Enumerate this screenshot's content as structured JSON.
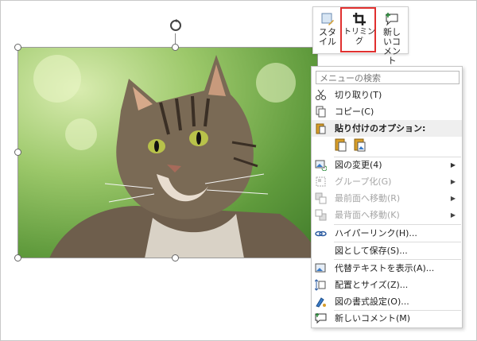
{
  "mini_toolbar": {
    "style_label": "スタイル",
    "trim_label": "トリミング",
    "comment_label": "新しいコメント"
  },
  "menu": {
    "search_placeholder": "メニューの検索",
    "items": [
      {
        "label": "切り取り(T)",
        "icon": "scissors-icon",
        "enabled": true
      },
      {
        "label": "コピー(C)",
        "icon": "copy-icon",
        "enabled": true
      },
      {
        "label": "貼り付けのオプション:",
        "icon": "paste-icon",
        "enabled": true,
        "header": true
      },
      {
        "label": "図の変更(4)",
        "icon": "change-picture-icon",
        "enabled": true,
        "submenu": true
      },
      {
        "label": "グループ化(G)",
        "icon": "group-icon",
        "enabled": false,
        "submenu": true
      },
      {
        "label": "最前面へ移動(R)",
        "icon": "bring-front-icon",
        "enabled": false,
        "submenu": true
      },
      {
        "label": "最背面へ移動(K)",
        "icon": "send-back-icon",
        "enabled": false,
        "submenu": true
      },
      {
        "label": "ハイパーリンク(H)...",
        "icon": "link-icon",
        "enabled": true
      },
      {
        "label": "図として保存(S)...",
        "icon": "",
        "enabled": true
      },
      {
        "label": "代替テキストを表示(A)...",
        "icon": "alt-text-icon",
        "enabled": true
      },
      {
        "label": "配置とサイズ(Z)...",
        "icon": "size-position-icon",
        "enabled": true
      },
      {
        "label": "図の書式設定(O)...",
        "icon": "format-picture-icon",
        "enabled": true
      },
      {
        "label": "新しいコメント(M)",
        "icon": "comment-icon",
        "enabled": true
      }
    ],
    "paste_options": [
      "paste-keep-icon",
      "paste-picture-icon"
    ]
  },
  "colors": {
    "highlight": "#e0302f",
    "disabled_text": "#a6a6a6"
  }
}
